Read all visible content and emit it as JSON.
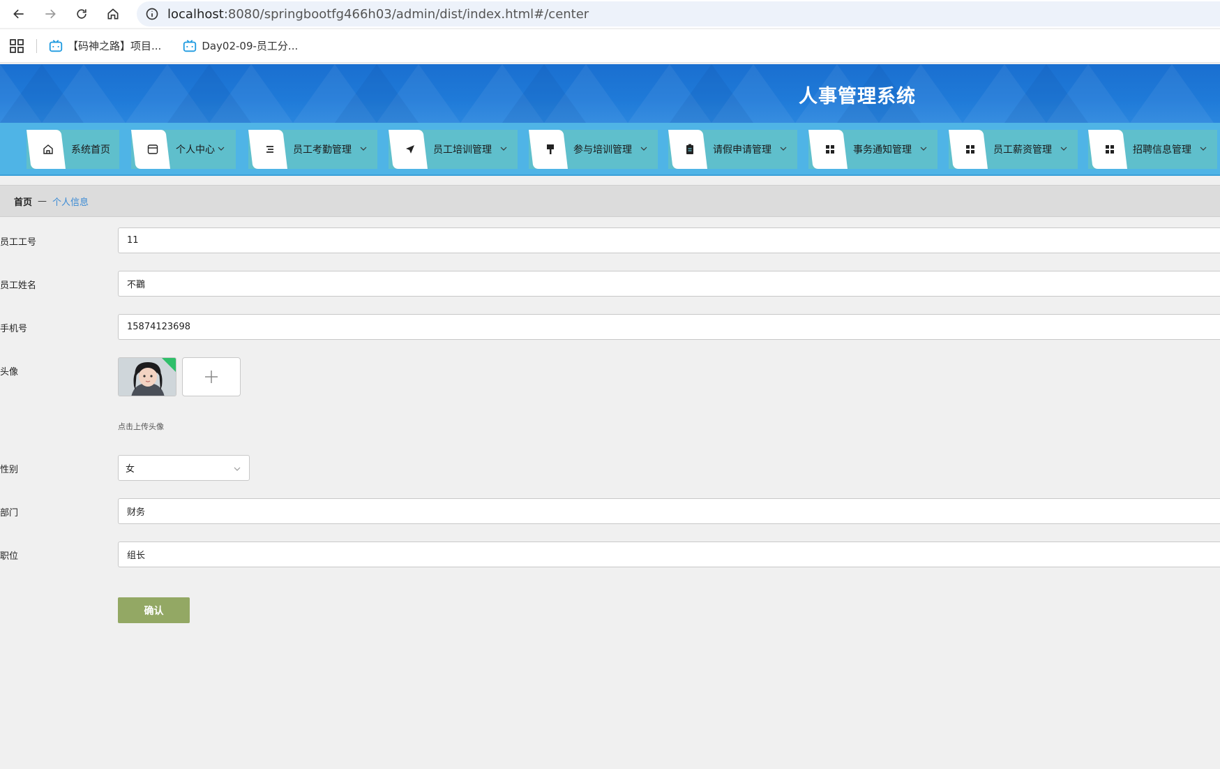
{
  "browser": {
    "url_host": "localhost",
    "url_rest": ":8080/springbootfg466h03/admin/dist/index.html#/center",
    "bookmarks": [
      {
        "label": "【码神之路】项目..."
      },
      {
        "label": "Day02-09-员工分..."
      }
    ]
  },
  "app": {
    "title": "人事管理系统"
  },
  "menu": {
    "items": [
      {
        "label": "系统首页"
      },
      {
        "label": "个人中心"
      },
      {
        "label": "员工考勤管理"
      },
      {
        "label": "员工培训管理"
      },
      {
        "label": "参与培训管理"
      },
      {
        "label": "请假申请管理"
      },
      {
        "label": "事务通知管理"
      },
      {
        "label": "员工薪资管理"
      },
      {
        "label": "招聘信息管理"
      }
    ]
  },
  "breadcrumb": {
    "home": "首页",
    "separator": "—",
    "current": "个人信息"
  },
  "form": {
    "employee_id": {
      "label": "员工工号",
      "value": "11"
    },
    "employee_name": {
      "label": "员工姓名",
      "value": "不鸐"
    },
    "phone": {
      "label": "手机号",
      "value": "15874123698"
    },
    "avatar": {
      "label": "头像",
      "hint": "点击上传头像"
    },
    "gender": {
      "label": "性别",
      "value": "女"
    },
    "department": {
      "label": "部门",
      "value": "财务"
    },
    "position": {
      "label": "职位",
      "value": "组长"
    },
    "confirm_label": "确认"
  },
  "colors": {
    "header_blue": "#1f7ad8",
    "menu_blue": "#4fb4e6",
    "menu_item": "#5fbfcc",
    "confirm": "#93a864",
    "crumb_link": "#3a8ad4"
  }
}
